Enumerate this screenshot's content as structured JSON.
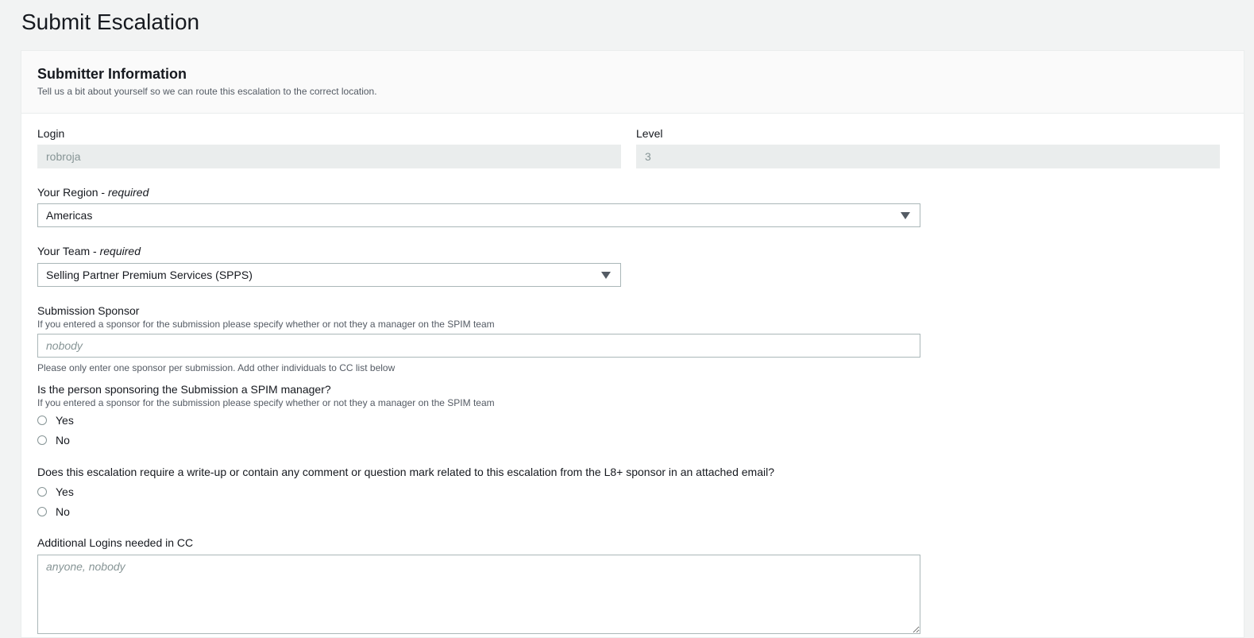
{
  "page": {
    "title": "Submit Escalation"
  },
  "panel": {
    "title": "Submitter Information",
    "description": "Tell us a bit about yourself so we can route this escalation to the correct location."
  },
  "login": {
    "label": "Login",
    "value": "robroja"
  },
  "level": {
    "label": "Level",
    "value": "3"
  },
  "region": {
    "label": "Your Region - ",
    "required": "required",
    "selected": "Americas"
  },
  "team": {
    "label": "Your Team - ",
    "required": "required",
    "selected": "Selling Partner Premium Services (SPPS)"
  },
  "sponsor": {
    "label": "Submission Sponsor",
    "hint": "If you entered a sponsor for the submission please specify whether or not they a manager on the SPIM team",
    "placeholder": "nobody",
    "help": "Please only enter one sponsor per submission. Add other individuals to CC list below"
  },
  "spim_manager": {
    "label": "Is the person sponsoring the Submission a SPIM manager?",
    "hint": "If you entered a sponsor for the submission please specify whether or not they a manager on the SPIM team",
    "options": [
      "Yes",
      "No"
    ]
  },
  "writeup": {
    "label": "Does this escalation require a write-up or contain any comment or question mark related to this escalation from the L8+ sponsor in an attached email?",
    "options": [
      "Yes",
      "No"
    ]
  },
  "cc": {
    "label": "Additional Logins needed in CC",
    "placeholder": "anyone, nobody"
  }
}
